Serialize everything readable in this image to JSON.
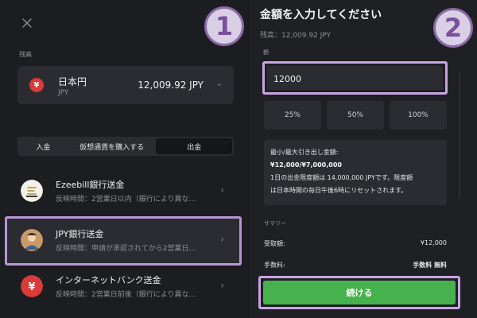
{
  "left": {
    "balance_label": "残高",
    "balance": {
      "currency_name": "日本円",
      "currency_code": "JPY",
      "amount": "12,009.92 JPY"
    },
    "tabs": [
      {
        "label": "入金",
        "active": false
      },
      {
        "label": "仮想通貨を購入する",
        "active": false
      },
      {
        "label": "出金",
        "active": true
      }
    ],
    "methods": [
      {
        "title": "Ezeebill銀行送金",
        "subtitle": "反映時間：2営業日以内（銀行により異な…",
        "icon": "ezeebill-logo-icon"
      },
      {
        "title": "JPY銀行送金",
        "subtitle": "反映時間：申請が承認されてから2営業日…",
        "icon": "avatar-icon",
        "highlighted": true
      },
      {
        "title": "インターネットバンク送金",
        "subtitle": "反映時間：2営業日前後（銀行により異な…",
        "icon": "yen-icon"
      }
    ]
  },
  "right": {
    "title": "金額を入力してください",
    "balance_line": "残高：12,009.92 JPY",
    "amount_label": "額",
    "amount_value": "12000",
    "percent_buttons": [
      "25%",
      "50%",
      "100%"
    ],
    "info": {
      "line1": "最小/最大引き出し金額:",
      "line2": "¥12,000/¥7,000,000",
      "line3": "1日の出金限度額は 14,000,000 JPYです。限度額",
      "line4": "は日本時間の毎日午後6時にリセットされます。"
    },
    "summary_label": "サマリー",
    "receive_label": "受取額:",
    "receive_value": "¥12,000",
    "fee_label": "手数料:",
    "fee_value": "手数料 無料",
    "continue_label": "続ける"
  },
  "badges": [
    "1",
    "2"
  ],
  "colors": {
    "accent_green": "#47b14d",
    "highlight_purple": "#c7a4e2",
    "badge_purple": "#7a4f9b",
    "yen_red": "#d93a3a"
  }
}
